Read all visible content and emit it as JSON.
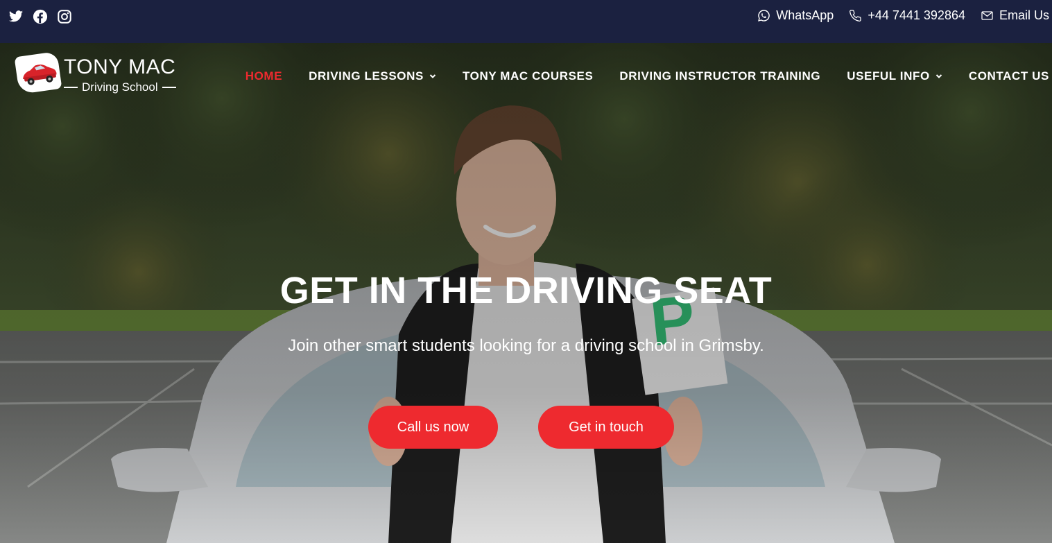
{
  "topbar": {
    "social_icons": [
      "twitter-icon",
      "facebook-icon",
      "instagram-icon"
    ],
    "contacts": [
      {
        "icon": "whatsapp-icon",
        "label": "WhatsApp"
      },
      {
        "icon": "phone-icon",
        "label": "+44 7441 392864"
      },
      {
        "icon": "mail-icon",
        "label": "Email Us"
      }
    ]
  },
  "logo": {
    "title": "TONY MAC",
    "subtitle": "Driving School"
  },
  "nav": {
    "items": [
      {
        "label": "HOME",
        "active": true,
        "dropdown": false
      },
      {
        "label": "DRIVING LESSONS",
        "active": false,
        "dropdown": true
      },
      {
        "label": "TONY MAC COURSES",
        "active": false,
        "dropdown": false
      },
      {
        "label": "DRIVING INSTRUCTOR TRAINING",
        "active": false,
        "dropdown": false
      },
      {
        "label": "USEFUL INFO",
        "active": false,
        "dropdown": true
      },
      {
        "label": "CONTACT US",
        "active": false,
        "dropdown": false
      }
    ]
  },
  "hero": {
    "title": "GET IN THE DRIVING SEAT",
    "subtitle": "Join other smart students looking for a driving school in Grimsby.",
    "cta_call": "Call us now",
    "cta_touch": "Get in touch",
    "plate_letter": "P"
  },
  "colors": {
    "topbar_bg": "#1b2140",
    "accent_red": "#ee2a2f",
    "l_plate_green": "#0f8a4a"
  }
}
